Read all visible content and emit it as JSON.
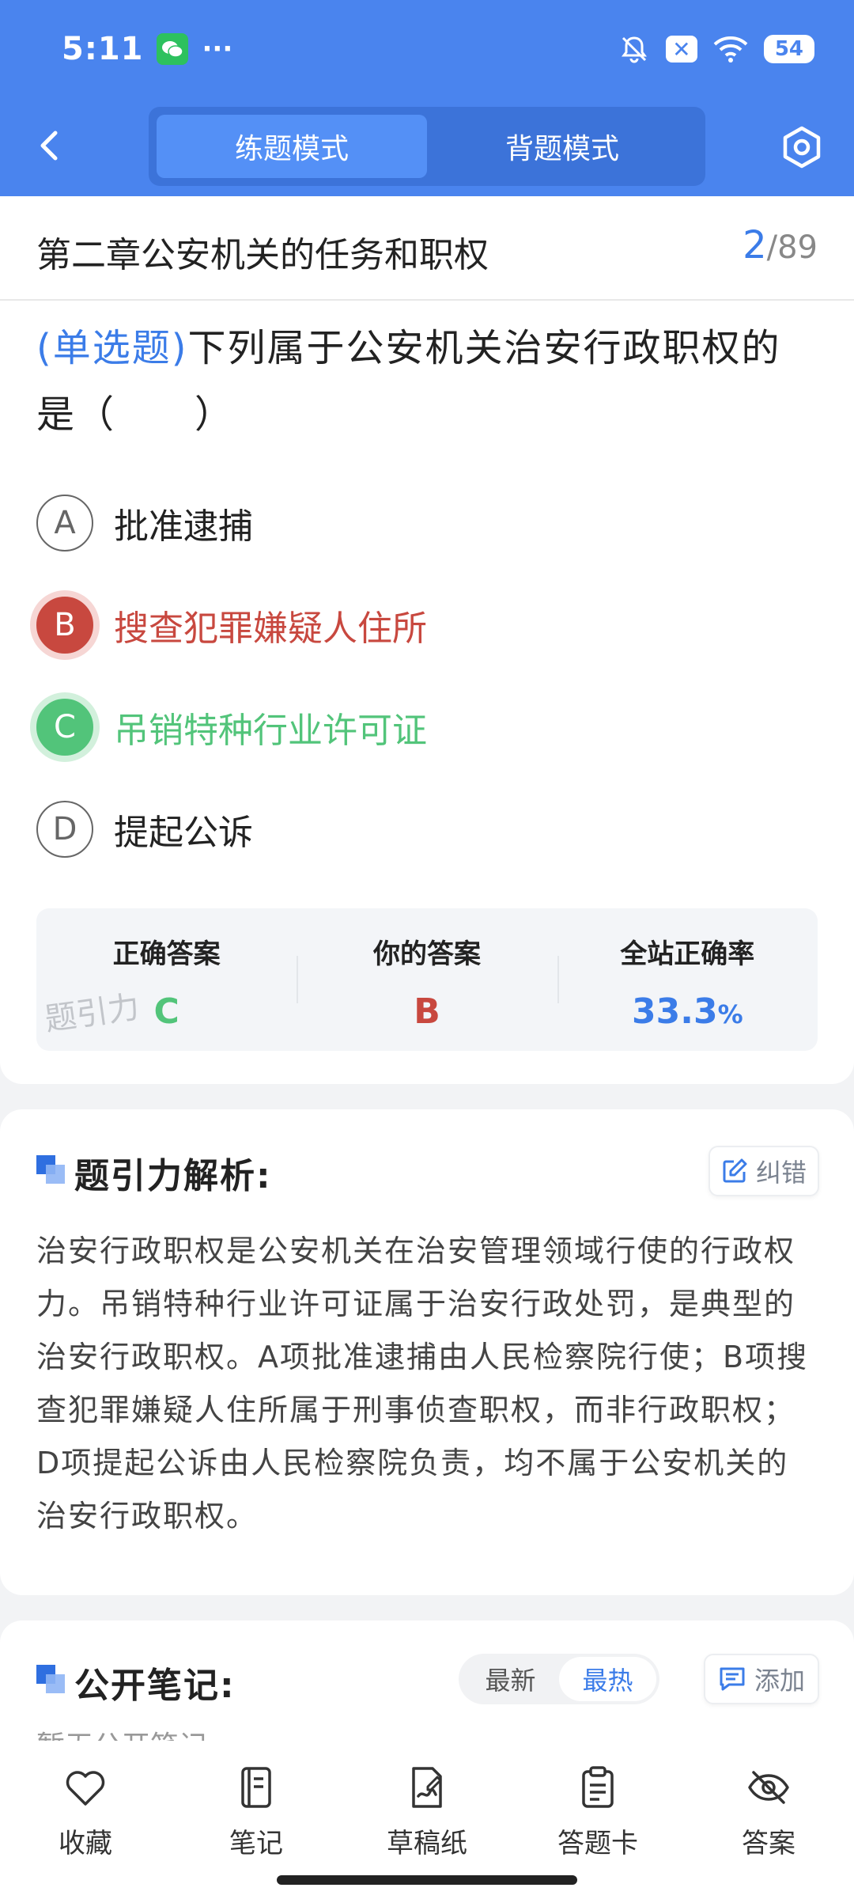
{
  "status_bar": {
    "time": "5:11",
    "more": "···",
    "battery": "54"
  },
  "header": {
    "tabs": [
      {
        "label": "练题模式",
        "active": true
      },
      {
        "label": "背题模式",
        "active": false
      }
    ]
  },
  "question": {
    "chapter": "第二章公安机关的任务和职权",
    "current": "2",
    "separator": "/",
    "total": "89",
    "type": "(单选题)",
    "text": "下列属于公安机关治安行政职权的是（　　）",
    "options": [
      {
        "letter": "A",
        "text": "批准逮捕",
        "state": "normal"
      },
      {
        "letter": "B",
        "text": "搜查犯罪嫌疑人住所",
        "state": "wrong"
      },
      {
        "letter": "C",
        "text": "吊销特种行业许可证",
        "state": "correct"
      },
      {
        "letter": "D",
        "text": "提起公诉",
        "state": "normal"
      }
    ]
  },
  "answer_summary": {
    "correct_label": "正确答案",
    "correct_value": "C",
    "mine_label": "你的答案",
    "mine_value": "B",
    "rate_label": "全站正确率",
    "rate_value": "33.3",
    "rate_unit": "%",
    "watermark": "题引力"
  },
  "analysis": {
    "title": "题引力解析:",
    "report_label": "纠错",
    "text": "治安行政职权是公安机关在治安管理领域行使的行政权力。吊销特种行业许可证属于治安行政处罚，是典型的治安行政职权。A项批准逮捕由人民检察院行使；B项搜查犯罪嫌疑人住所属于刑事侦查职权，而非行政职权；D项提起公诉由人民检察院负责，均不属于公安机关的治安行政职权。"
  },
  "notes": {
    "title": "公开笔记:",
    "sort_options": [
      {
        "label": "最新",
        "active": false
      },
      {
        "label": "最热",
        "active": true
      }
    ],
    "add_label": "添加",
    "empty_text": "暂无公开笔记"
  },
  "bottom_nav": [
    {
      "label": "收藏",
      "icon": "heart-icon"
    },
    {
      "label": "笔记",
      "icon": "notebook-icon"
    },
    {
      "label": "草稿纸",
      "icon": "draft-paper-icon"
    },
    {
      "label": "答题卡",
      "icon": "clipboard-icon"
    },
    {
      "label": "答案",
      "icon": "eye-off-icon"
    }
  ],
  "colors": {
    "primary": "#4a84ee",
    "accent_blue": "#3b7ce8",
    "wrong_red": "#c8483f",
    "correct_green": "#52c47a"
  }
}
